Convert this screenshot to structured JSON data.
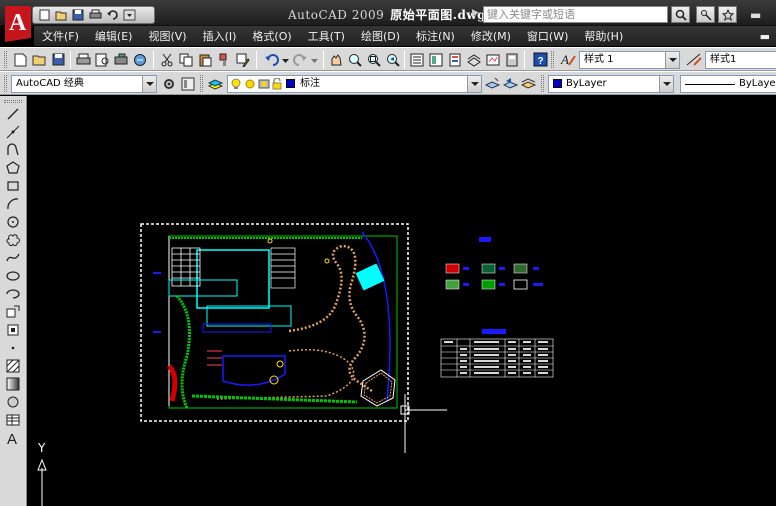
{
  "titlebar": {
    "app_title": "AutoCAD 2009",
    "file_name": "原始平面图.dwg",
    "search_placeholder": "键入关键字或短语"
  },
  "menu": [
    {
      "label": "文件(F)"
    },
    {
      "label": "编辑(E)"
    },
    {
      "label": "视图(V)"
    },
    {
      "label": "插入(I)"
    },
    {
      "label": "格式(O)"
    },
    {
      "label": "工具(T)"
    },
    {
      "label": "绘图(D)"
    },
    {
      "label": "标注(N)"
    },
    {
      "label": "修改(M)"
    },
    {
      "label": "窗口(W)"
    },
    {
      "label": "帮助(H)"
    }
  ],
  "toolbar": {
    "text_style": "样式 1",
    "dim_style": "样式1"
  },
  "workspace": {
    "name": "AutoCAD 经典",
    "layer": "标注",
    "color": "ByLayer",
    "linetype": "ByLayer"
  },
  "ucs": {
    "y_label": "Y"
  },
  "colors": {
    "layer_color": "#0000c8",
    "cyan": "#00ffff",
    "white": "#ffffff",
    "green": "#00c800",
    "blue": "#1a1aff",
    "red": "#d00000",
    "yellow": "#ffe000"
  }
}
